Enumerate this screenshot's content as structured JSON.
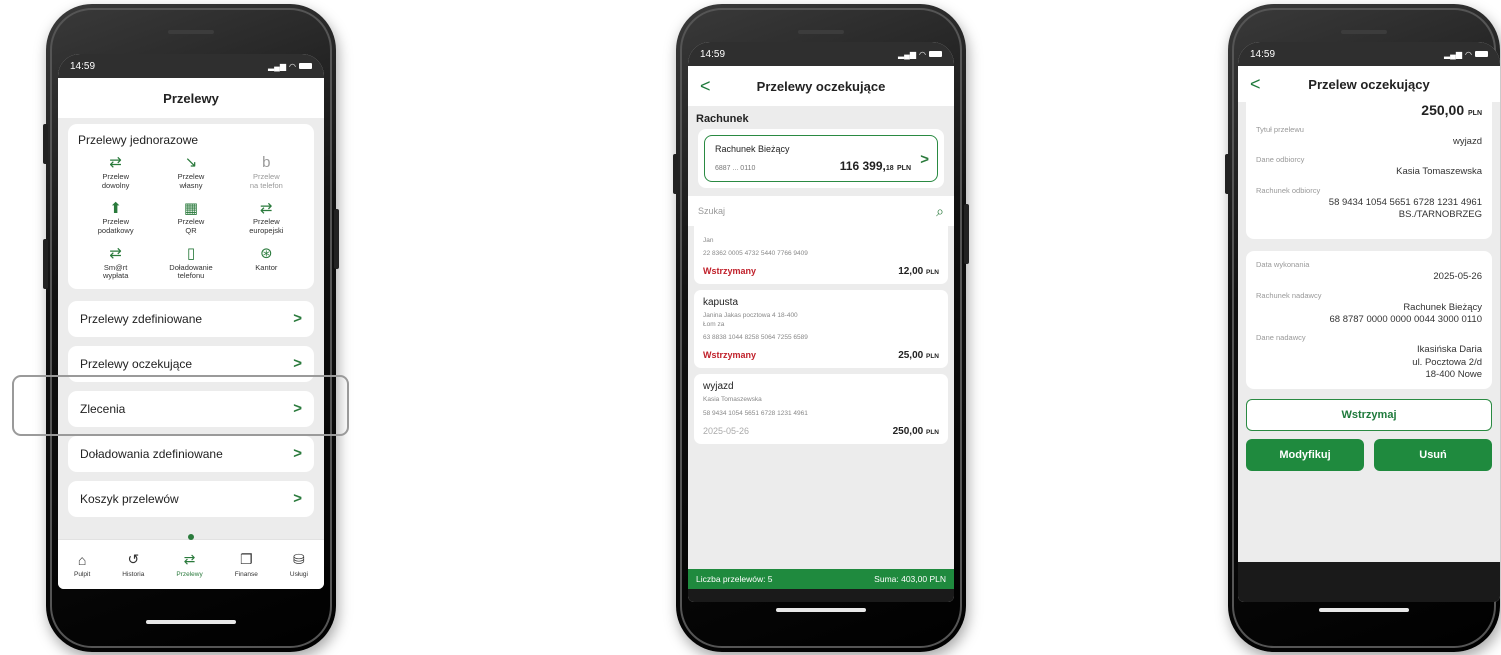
{
  "status": {
    "time": "14:59"
  },
  "screen1": {
    "title": "Przelewy",
    "onetime": {
      "title": "Przelewy jednorazowe",
      "items": [
        {
          "label": "Przelew\ndowolny",
          "icon": "transfer-arrows-icon",
          "glyph": "⇄"
        },
        {
          "label": "Przelew\nwłasny",
          "icon": "arrow-down-right-icon",
          "glyph": "↘"
        },
        {
          "label": "Przelew\nna telefon",
          "icon": "blik-icon",
          "glyph": "b"
        },
        {
          "label": "Przelew\npodatkowy",
          "icon": "tax-document-icon",
          "glyph": "⬆"
        },
        {
          "label": "Przelew\nQR",
          "icon": "qr-code-icon",
          "glyph": "▦"
        },
        {
          "label": "Przelew\neuropejski",
          "icon": "transfer-arrows-icon",
          "glyph": "⇄"
        },
        {
          "label": "Sm@rt\nwypłata",
          "icon": "transfer-arrows-icon",
          "glyph": "⇄"
        },
        {
          "label": "Doładowanie\ntelefonu",
          "icon": "phone-topup-icon",
          "glyph": "▯"
        },
        {
          "label": "Kantor",
          "icon": "currency-exchange-icon",
          "glyph": "⊛"
        }
      ]
    },
    "menu": [
      "Przelewy zdefiniowane",
      "Przelewy oczekujące",
      "Zlecenia",
      "Doładowania zdefiniowane",
      "Koszyk przelewów"
    ],
    "tabs": [
      {
        "label": "Pulpit",
        "glyph": "⌂",
        "icon": "home-icon"
      },
      {
        "label": "Historia",
        "glyph": "↺",
        "icon": "history-icon"
      },
      {
        "label": "Przelewy",
        "glyph": "⇄",
        "icon": "transfers-icon"
      },
      {
        "label": "Finanse",
        "glyph": "❐",
        "icon": "wallet-icon"
      },
      {
        "label": "Usługi",
        "glyph": "⛁",
        "icon": "database-icon"
      }
    ]
  },
  "screen2": {
    "title": "Przelewy oczekujące",
    "section": "Rachunek",
    "account": {
      "name": "Rachunek Bieżący",
      "number": "6887 ... 0110",
      "balance_main": "116 399,",
      "balance_dec": "18",
      "currency": "PLN"
    },
    "search_placeholder": "Szukaj",
    "transfers": [
      {
        "name": "Jan",
        "address": "",
        "account": "22 8362 0005 4732 5440 7766 9409",
        "status": "Wstrzymany",
        "amount_main": "12,00",
        "currency": "PLN"
      },
      {
        "name": "kapusta",
        "address": "Janina Jakas  pocztowa 4 18-400\nŁom za",
        "account": "63 8838 1044 8258 5064 7255 6589",
        "status": "Wstrzymany",
        "amount_main": "25,00",
        "currency": "PLN"
      },
      {
        "name": "wyjazd",
        "address": "Kasia Tomaszewska",
        "account": "58 9434 1054 5651 6728 1231 4961",
        "status": "2025-05-26",
        "amount_main": "250,00",
        "currency": "PLN"
      }
    ],
    "summary": {
      "count": "Liczba przelewów: 5",
      "total": "Suma: 403,00 PLN"
    }
  },
  "screen3": {
    "title": "Przelew oczekujący",
    "amount_main": "250,00",
    "currency": "PLN",
    "fields1": [
      {
        "label": "Tytuł przelewu",
        "value": "wyjazd"
      },
      {
        "label": "Dane odbiorcy",
        "value": "Kasia Tomaszewska"
      },
      {
        "label": "Rachunek odbiorcy",
        "value": "58 9434 1054 5651 6728 1231 4961\nBS./TARNOBRZEG"
      }
    ],
    "fields2": [
      {
        "label": "Data wykonania",
        "value": "2025-05-26"
      },
      {
        "label": "Rachunek nadawcy",
        "value": "Rachunek Bieżący\n68 8787 0000 0000 0044 3000 0110"
      },
      {
        "label": "Dane nadawcy",
        "value": "Ikasińska Daria\nul. Pocztowa 2/d\n18-400 Nowe"
      }
    ],
    "buttons": {
      "hold": "Wstrzymaj",
      "modify": "Modyfikuj",
      "delete": "Usuń"
    }
  }
}
